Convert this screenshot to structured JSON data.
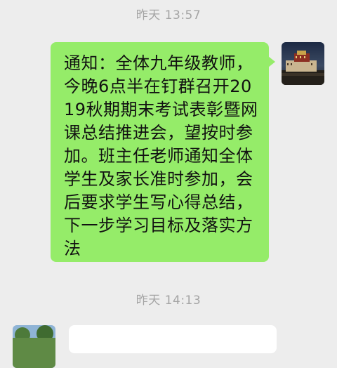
{
  "timestamps": {
    "first": "昨天 13:57",
    "second": "昨天 14:13"
  },
  "messages": [
    {
      "direction": "outgoing",
      "text": "通知：全体九年级教师，今晚6点半在钉群召开2019秋期期末考试表彰暨网课总结推进会，望按时参加。班主任老师通知全体学生及家长准时参加，会后要求学生写心得总结，下一步学习目标及落实方法"
    }
  ],
  "colors": {
    "background": "#ededed",
    "outgoing_bubble": "#95ec69",
    "incoming_bubble": "#ffffff",
    "timestamp_text": "#a4a4a4"
  }
}
